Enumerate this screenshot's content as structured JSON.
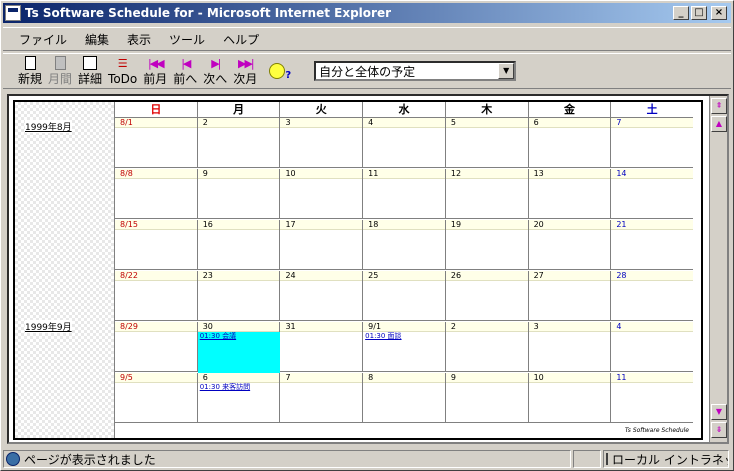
{
  "window": {
    "title": "Ts Software Schedule for - Microsoft Internet Explorer",
    "controls": {
      "minimize": "_",
      "maximize": "□",
      "close": "×"
    }
  },
  "menu": [
    "ファイル",
    "編集",
    "表示",
    "ツール",
    "ヘルプ"
  ],
  "toolbar": {
    "buttons": [
      {
        "label": "新規",
        "icon": "new-doc-icon",
        "enabled": true
      },
      {
        "label": "月間",
        "icon": "month-calendar-icon",
        "enabled": false
      },
      {
        "label": "詳細",
        "icon": "detail-icon",
        "enabled": true
      },
      {
        "label": "ToDo",
        "icon": "todo-icon",
        "enabled": true
      },
      {
        "label": "前月",
        "icon": "prev-month-icon",
        "enabled": true
      },
      {
        "label": "前へ",
        "icon": "prev-icon",
        "enabled": true
      },
      {
        "label": "次へ",
        "icon": "next-icon",
        "enabled": true
      },
      {
        "label": "次月",
        "icon": "next-month-icon",
        "enabled": true
      }
    ],
    "help_icon": "bulb-help-icon",
    "view_select": {
      "value": "自分と全体の予定"
    }
  },
  "calendar": {
    "month_labels": [
      "1999年8月",
      "1999年9月"
    ],
    "weekdays": [
      "日",
      "月",
      "火",
      "水",
      "木",
      "金",
      "土"
    ],
    "weeks": [
      {
        "days": [
          {
            "d": "8/1"
          },
          {
            "d": "2"
          },
          {
            "d": "3"
          },
          {
            "d": "4"
          },
          {
            "d": "5"
          },
          {
            "d": "6"
          },
          {
            "d": "7"
          }
        ]
      },
      {
        "days": [
          {
            "d": "8/8"
          },
          {
            "d": "9"
          },
          {
            "d": "10"
          },
          {
            "d": "11"
          },
          {
            "d": "12"
          },
          {
            "d": "13"
          },
          {
            "d": "14"
          }
        ]
      },
      {
        "days": [
          {
            "d": "8/15"
          },
          {
            "d": "16"
          },
          {
            "d": "17"
          },
          {
            "d": "18"
          },
          {
            "d": "19"
          },
          {
            "d": "20"
          },
          {
            "d": "21"
          }
        ]
      },
      {
        "days": [
          {
            "d": "8/22"
          },
          {
            "d": "23"
          },
          {
            "d": "24"
          },
          {
            "d": "25"
          },
          {
            "d": "26"
          },
          {
            "d": "27"
          },
          {
            "d": "28"
          }
        ]
      },
      {
        "days": [
          {
            "d": "8/29"
          },
          {
            "d": "30",
            "event": "01:30 会議",
            "highlight": true
          },
          {
            "d": "31"
          },
          {
            "d": "9/1",
            "event": "01:30 面談"
          },
          {
            "d": "2"
          },
          {
            "d": "3"
          },
          {
            "d": "4"
          }
        ]
      },
      {
        "days": [
          {
            "d": "9/5"
          },
          {
            "d": "6",
            "event": "01:30 来客訪問"
          },
          {
            "d": "7"
          },
          {
            "d": "8"
          },
          {
            "d": "9"
          },
          {
            "d": "10"
          },
          {
            "d": "11"
          }
        ]
      }
    ],
    "footer_brand": "Ts Software Schedule",
    "highlight_color": "#00ffff"
  },
  "statusbar": {
    "message": "ページが表示されました",
    "zone": "ローカル イントラネット"
  }
}
